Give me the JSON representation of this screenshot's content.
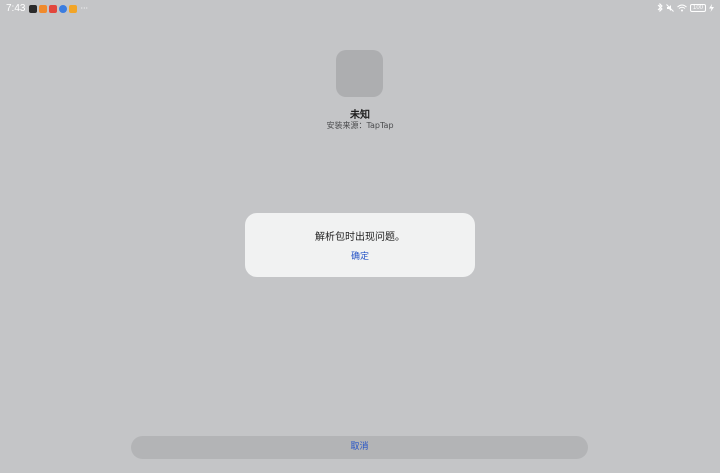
{
  "status_bar": {
    "time": "7:43",
    "notifications": [
      {
        "icon": "penguin-app-icon",
        "color": "#2a2a2a",
        "glyph": "◉"
      },
      {
        "icon": "orange-app-icon",
        "color": "#f08a2c",
        "glyph": "▶"
      },
      {
        "icon": "red-app-icon",
        "color": "#e2463c",
        "glyph": "■"
      },
      {
        "icon": "blue-app-icon",
        "color": "#3b7de0",
        "glyph": "●"
      },
      {
        "icon": "yellow-app-icon",
        "color": "#f2a527",
        "glyph": "▲"
      }
    ],
    "more_label": "···",
    "battery_level": "100"
  },
  "app": {
    "name": "未知",
    "install_source": "安装来源：TapTap"
  },
  "dialog": {
    "message": "解析包时出现问题。",
    "ok_label": "确定"
  },
  "footer": {
    "cancel_label": "取消"
  },
  "colors": {
    "background": "#c4c5c7",
    "accent": "#2553c7",
    "dialog_bg": "#f1f2f2"
  }
}
